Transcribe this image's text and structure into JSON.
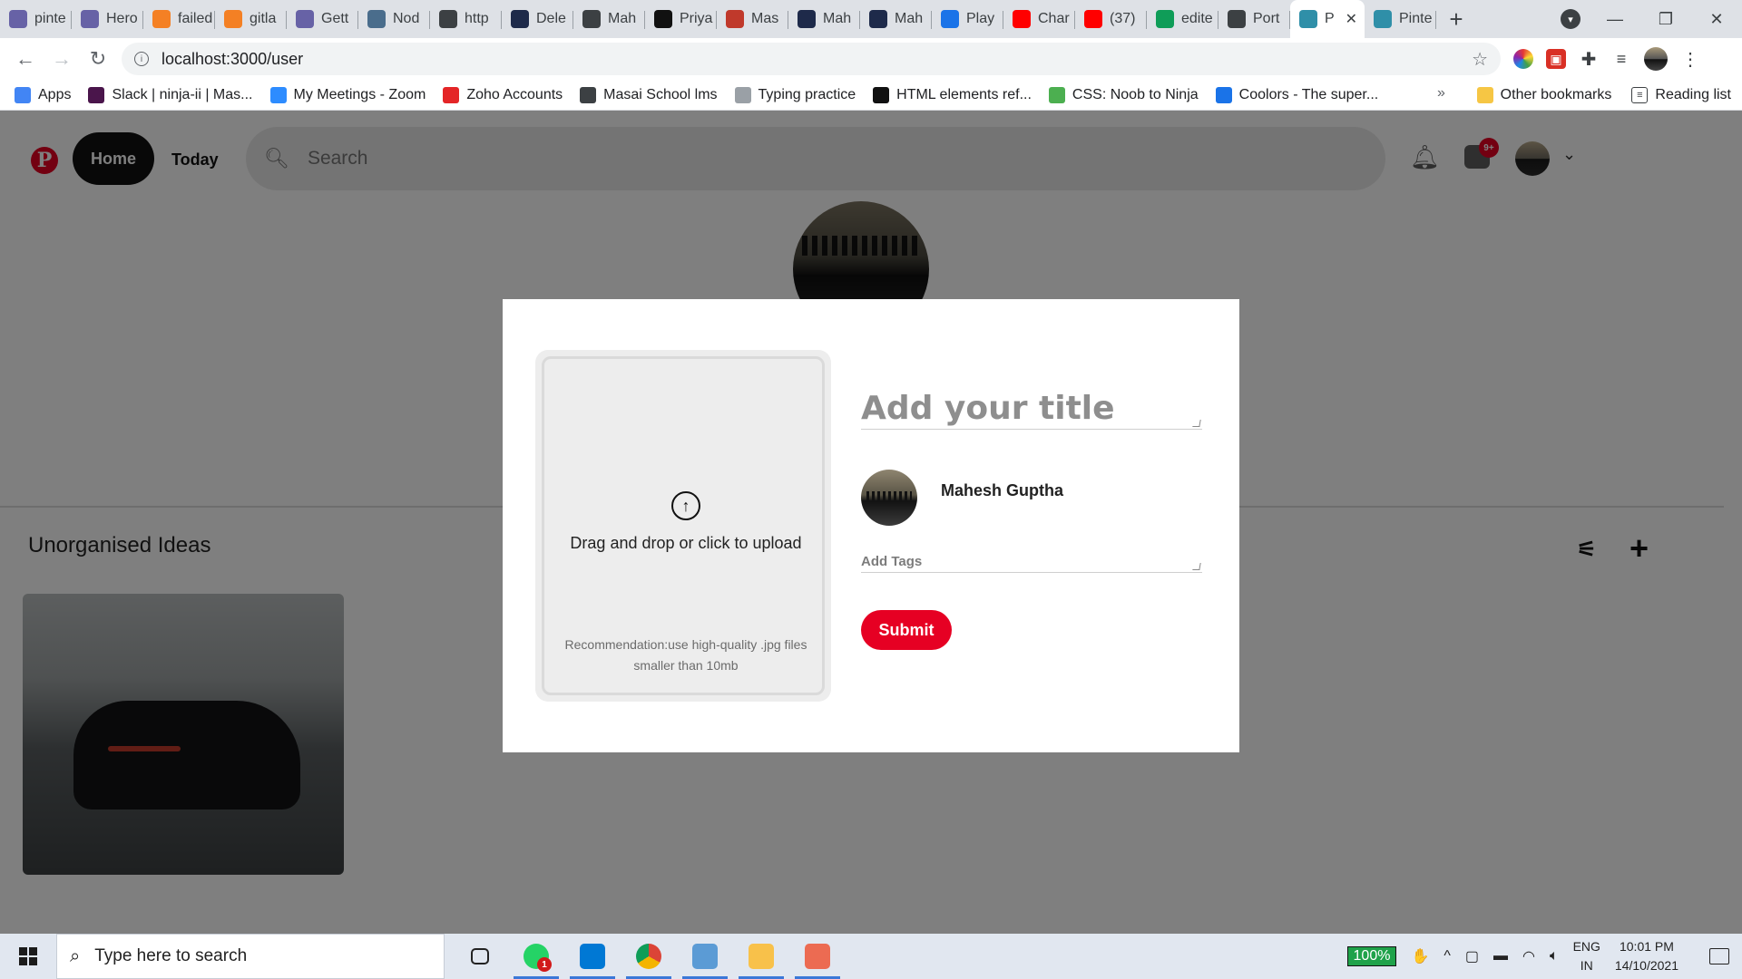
{
  "browser": {
    "tabs": [
      {
        "label": "pinte",
        "icon": "heroku-icon",
        "color": "#6762a6"
      },
      {
        "label": "Hero",
        "icon": "heroku-icon",
        "color": "#6762a6"
      },
      {
        "label": "failed",
        "icon": "stackoverflow-icon",
        "color": "#f48024"
      },
      {
        "label": "gitla",
        "icon": "stackoverflow-icon",
        "color": "#f48024"
      },
      {
        "label": "Gett",
        "icon": "heroku-icon",
        "color": "#6762a6"
      },
      {
        "label": "Nod",
        "icon": "cloud-icon",
        "color": "#4a6d8c"
      },
      {
        "label": "http",
        "icon": "globe-icon",
        "color": "#3c4043"
      },
      {
        "label": "Dele",
        "icon": "blank-icon",
        "color": "#1e2a4a"
      },
      {
        "label": "Mah",
        "icon": "globe-icon",
        "color": "#3c4043"
      },
      {
        "label": "Priya",
        "icon": "hashnode-icon",
        "color": "#111111"
      },
      {
        "label": "Mas",
        "icon": "masai-icon",
        "color": "#c0392b"
      },
      {
        "label": "Mah",
        "icon": "m-icon",
        "color": "#1e2a4a"
      },
      {
        "label": "Mah",
        "icon": "m-icon",
        "color": "#1e2a4a"
      },
      {
        "label": "Play",
        "icon": "flag-icon",
        "color": "#1a73e8"
      },
      {
        "label": "Char",
        "icon": "youtube-icon",
        "color": "#ff0000"
      },
      {
        "label": "(37)",
        "icon": "youtube-icon",
        "color": "#ff0000"
      },
      {
        "label": "edite",
        "icon": "drive-icon",
        "color": "#0f9d58"
      },
      {
        "label": "Port",
        "icon": "globe-icon",
        "color": "#3c4043"
      },
      {
        "label": "P",
        "icon": "react-icon",
        "color": "#2f8fa8",
        "active": true
      },
      {
        "label": "Pinte",
        "icon": "react-icon",
        "color": "#2f8fa8"
      }
    ],
    "url": "localhost:3000/user",
    "bookmarks": [
      {
        "label": "Apps",
        "icon": "apps-grid-icon",
        "color": "#4285f4"
      },
      {
        "label": "Slack | ninja-ii | Mas...",
        "icon": "slack-icon",
        "color": "#4a154b"
      },
      {
        "label": "My Meetings - Zoom",
        "icon": "zoom-icon",
        "color": "#2d8cff"
      },
      {
        "label": "Zoho Accounts",
        "icon": "zoho-icon",
        "color": "#e42527"
      },
      {
        "label": "Masai School lms",
        "icon": "globe-icon",
        "color": "#3c4043"
      },
      {
        "label": "Typing practice",
        "icon": "keyboard-icon",
        "color": "#9aa0a6"
      },
      {
        "label": "HTML elements ref...",
        "icon": "mdn-icon",
        "color": "#111111"
      },
      {
        "label": "CSS: Noob to Ninja",
        "icon": "leaf-icon",
        "color": "#4caf50"
      },
      {
        "label": "Coolors - The super...",
        "icon": "coolors-icon",
        "color": "#1a73e8"
      }
    ],
    "bookmarks_more": "»",
    "other_bookmarks": "Other bookmarks",
    "reading_list": "Reading list"
  },
  "app": {
    "logo": "P",
    "nav_home": "Home",
    "nav_today": "Today",
    "search_placeholder": "Search",
    "messages_badge": "9+",
    "board_title": "Unorganised Ideas",
    "accent_color": "#e60023"
  },
  "modal": {
    "upload_text": "Drag and drop or click to upload",
    "upload_recommendation": "Recommendation:use high-quality .jpg files smaller than 10mb",
    "title_placeholder": "Add your title",
    "author_name": "Mahesh Guptha",
    "tags_placeholder": "Add Tags",
    "submit_label": "Submit"
  },
  "taskbar": {
    "search_placeholder": "Type here to search",
    "apps": [
      {
        "name": "task-view-icon",
        "running": false
      },
      {
        "name": "whatsapp-icon",
        "running": true,
        "badge": "1"
      },
      {
        "name": "vscode-icon",
        "running": true
      },
      {
        "name": "chrome-icon",
        "running": true
      },
      {
        "name": "notes-icon",
        "running": true
      },
      {
        "name": "file-explorer-icon",
        "running": true
      },
      {
        "name": "git-icon",
        "running": true
      }
    ],
    "battery": "100%",
    "lang_top": "ENG",
    "lang_bottom": "IN",
    "time": "10:01 PM",
    "date": "14/10/2021"
  }
}
